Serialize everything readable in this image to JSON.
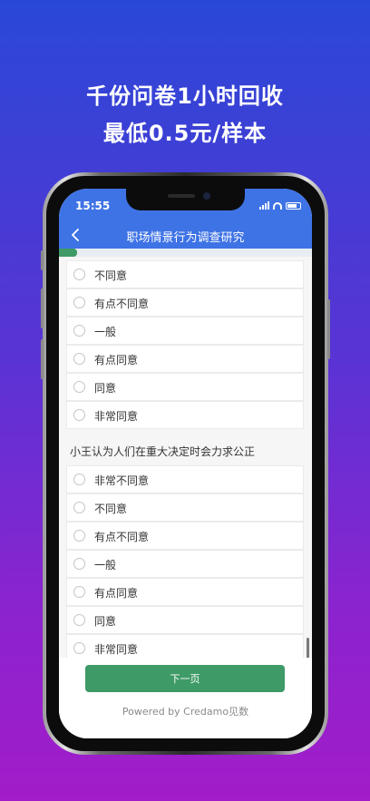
{
  "promo": {
    "headline_line1": "千份问卷1小时回收",
    "headline_line2": "最低0.5元/样本"
  },
  "status_bar": {
    "time": "15:55"
  },
  "app_bar": {
    "title": "职场情景行为调查研究",
    "back_icon": "chevron-left-icon"
  },
  "progress": {
    "fraction": 0.07,
    "color": "#3e9a66"
  },
  "question_1": {
    "options": [
      "不同意",
      "有点不同意",
      "一般",
      "有点同意",
      "同意",
      "非常同意"
    ]
  },
  "question_2": {
    "text": "小王认为人们在重大决定时会力求公正",
    "options": [
      "非常不同意",
      "不同意",
      "有点不同意",
      "一般",
      "有点同意",
      "同意",
      "非常同意"
    ]
  },
  "footer": {
    "next_label": "下一页",
    "powered_by": "Powered by Credamo见数"
  },
  "colors": {
    "app_bar": "#3e73e6",
    "accent_green": "#3e9a66",
    "background_top": "#2a48d6",
    "background_bottom": "#a21cc9"
  }
}
